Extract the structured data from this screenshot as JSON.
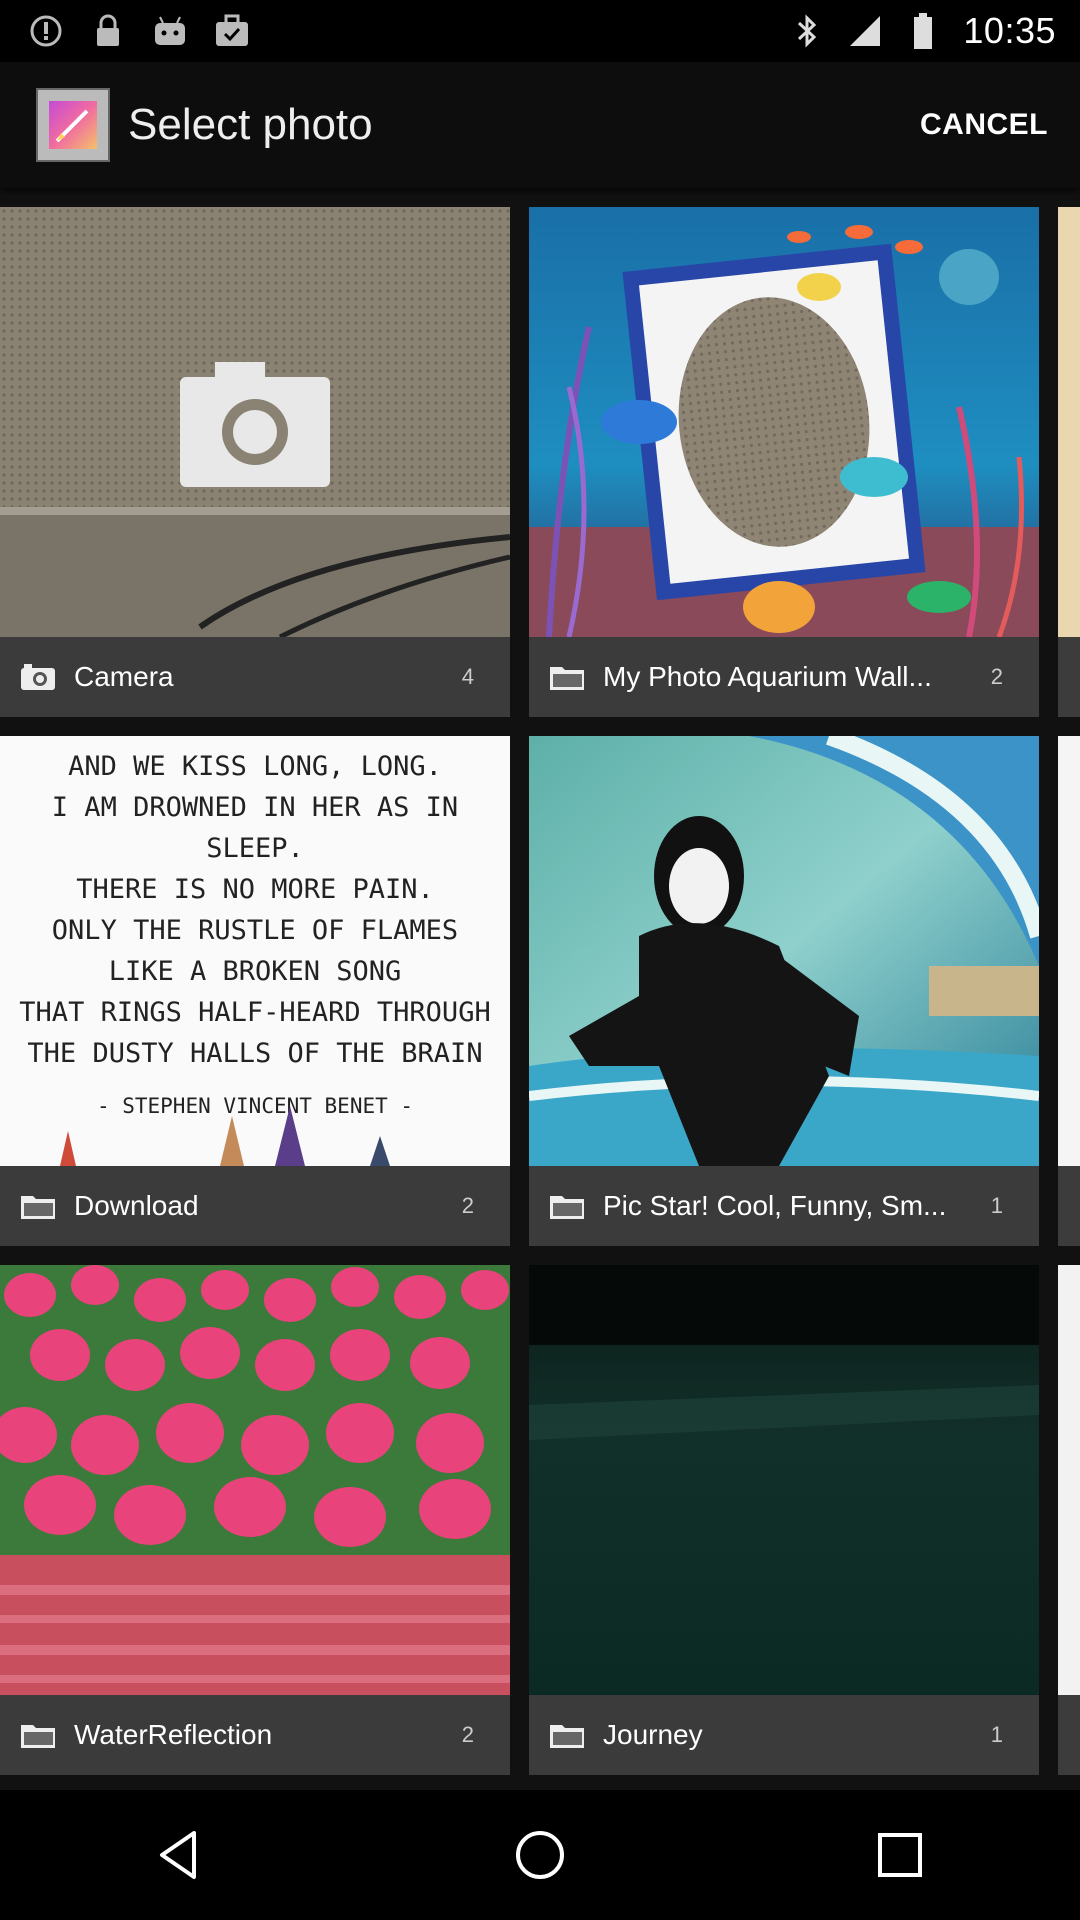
{
  "status_bar": {
    "time": "10:35",
    "left_icons": [
      "alert-icon",
      "lock-icon",
      "android-icon",
      "bag-check-icon"
    ],
    "right_icons": [
      "bluetooth-icon",
      "signal-icon",
      "battery-icon"
    ]
  },
  "app_bar": {
    "title": "Select photo",
    "cancel_label": "CANCEL",
    "app_icon": "photo-editor-icon"
  },
  "albums": [
    {
      "label": "Camera",
      "count": "4",
      "icon": "camera-icon"
    },
    {
      "label": "My Photo Aquarium Wall...",
      "count": "2",
      "icon": "folder-icon"
    },
    {
      "label": "Download",
      "count": "2",
      "icon": "folder-icon"
    },
    {
      "label": "Pic Star! Cool, Funny, Sm...",
      "count": "1",
      "icon": "folder-icon"
    },
    {
      "label": "WaterReflection",
      "count": "2",
      "icon": "folder-icon"
    },
    {
      "label": "Journey",
      "count": "1",
      "icon": "folder-icon"
    }
  ],
  "poem": {
    "lines": [
      "AND WE KISS LONG, LONG.",
      "I AM DROWNED IN HER AS IN SLEEP.",
      "THERE IS NO MORE PAIN.",
      "ONLY THE RUSTLE OF FLAMES",
      "LIKE A BROKEN SONG",
      "THAT RINGS HALF-HEARD THROUGH",
      "THE DUSTY HALLS OF THE BRAIN",
      "- STEPHEN VINCENT BENET -"
    ]
  },
  "nav_bar": {
    "buttons": [
      "back-icon",
      "home-icon",
      "recents-icon"
    ]
  }
}
